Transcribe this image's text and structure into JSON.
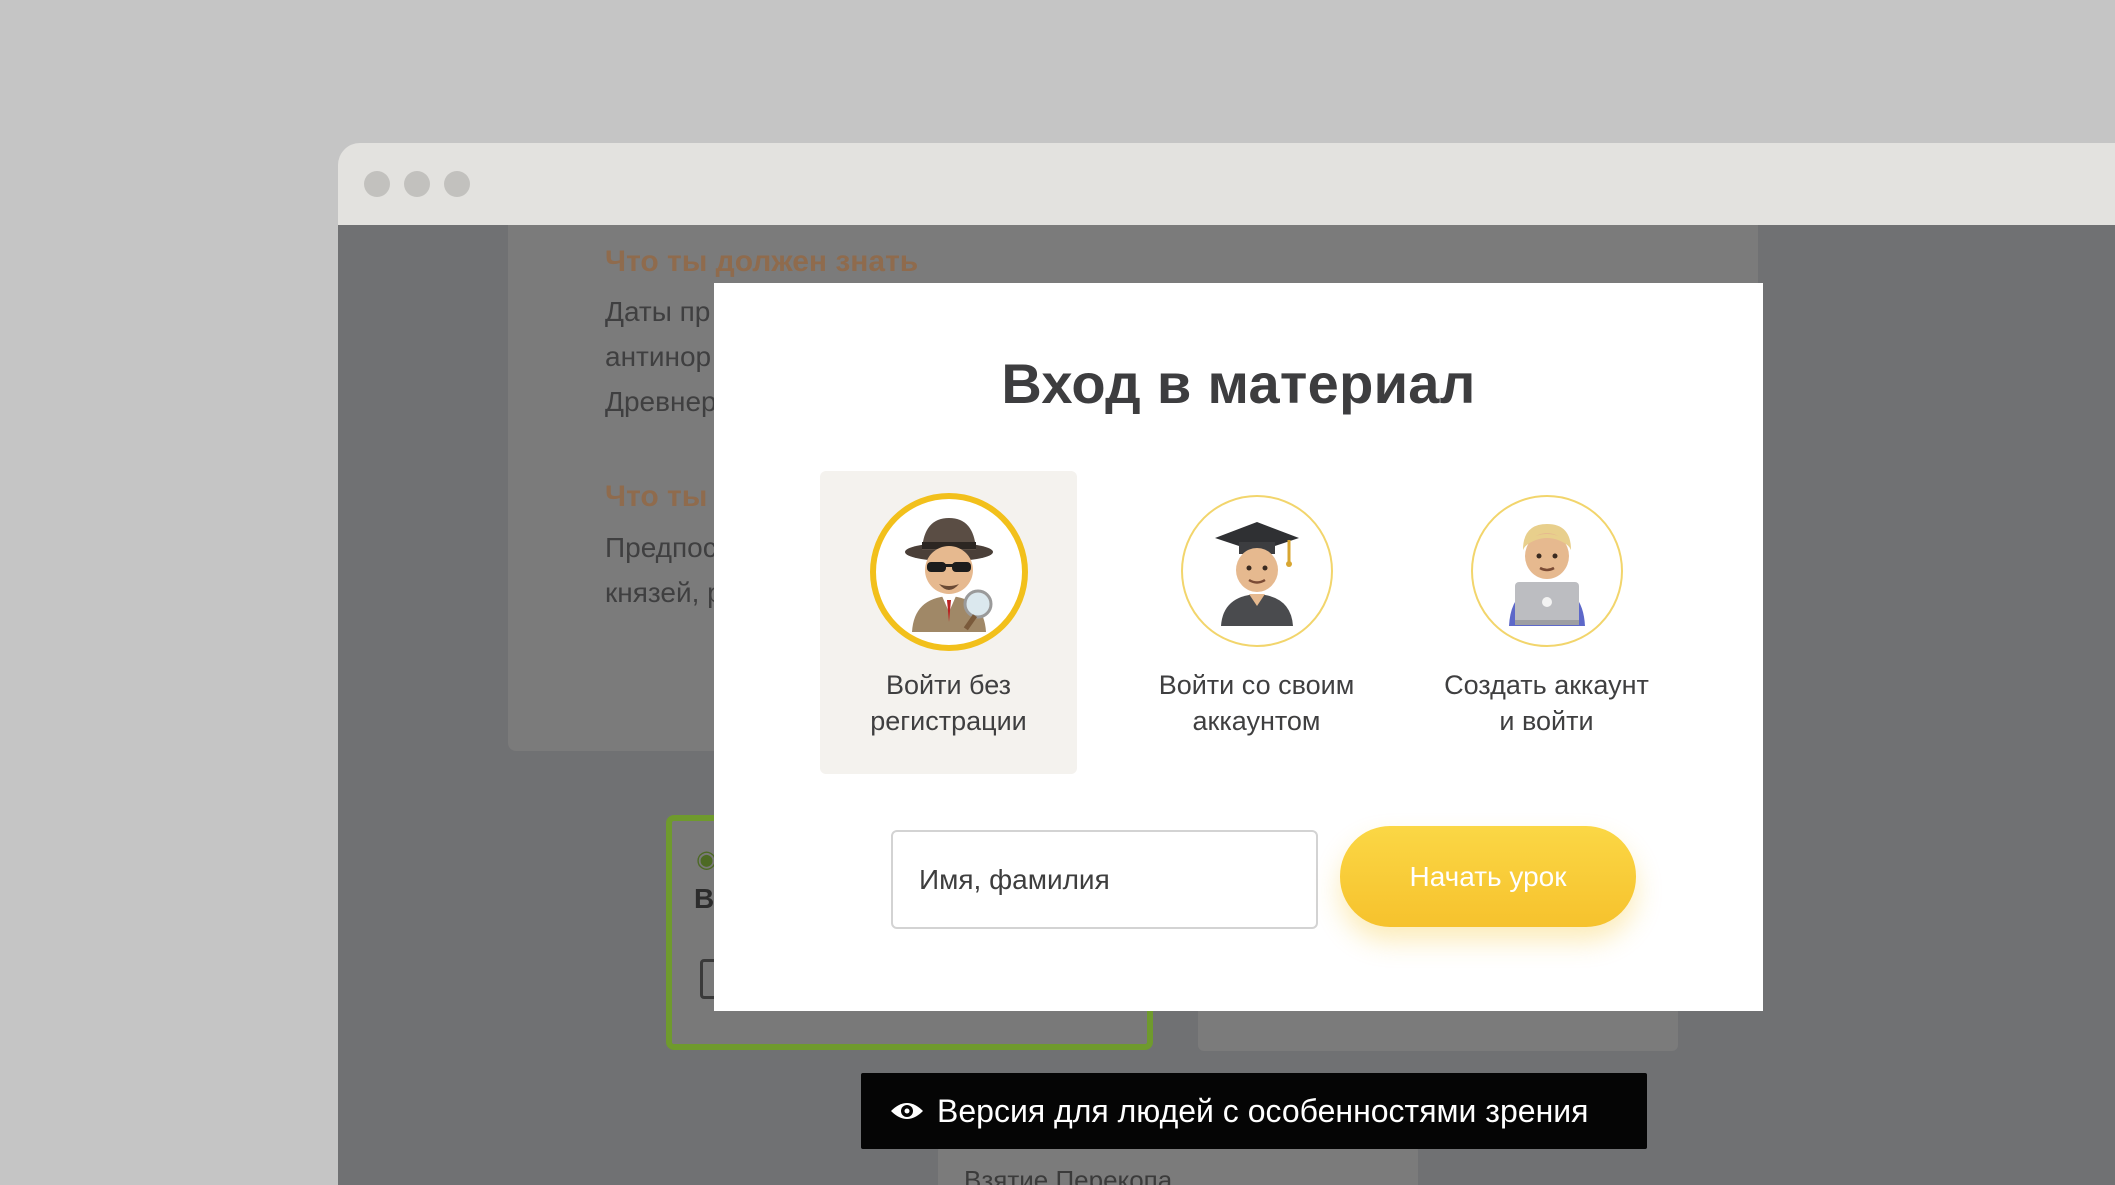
{
  "background_page": {
    "heading_1": "Что ты должен знать",
    "text_lines_1": [
      "Даты пр",
      "антинор",
      "Древнер"
    ],
    "heading_2": "Что ты",
    "text_lines_2": [
      "Предпос",
      "князей, р"
    ],
    "quiz_left_letter": "В",
    "bottom_item": "Взятие Перекопа"
  },
  "modal": {
    "title": "Вход в материал",
    "options": [
      {
        "label": "Войти без\nрегистрации",
        "icon": "detective-icon",
        "selected": true
      },
      {
        "label": "Войти со своим\nаккаунтом",
        "icon": "graduate-icon",
        "selected": false
      },
      {
        "label": "Создать аккаунт\nи войти",
        "icon": "laptop-user-icon",
        "selected": false
      }
    ],
    "name_input": {
      "placeholder": "Имя, фамилия",
      "value": ""
    },
    "start_button": "Начать урок"
  },
  "accessibility_bar": {
    "label": "Версия для людей с особенностями зрения",
    "icon": "eye-icon"
  },
  "colors": {
    "accent_yellow": "#F6C22D",
    "selected_ring": "#F2C01B",
    "quiz_border_green": "#6F9A2D",
    "overlay": "#707173"
  }
}
